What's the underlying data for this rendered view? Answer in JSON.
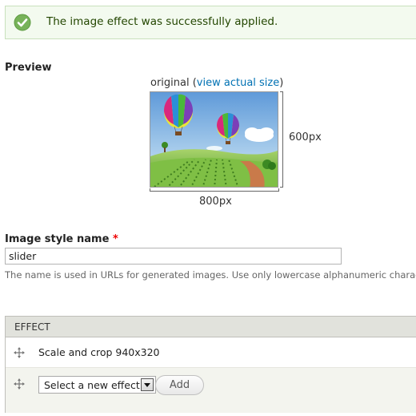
{
  "status": {
    "icon": "check-circle-icon",
    "message": "The image effect was successfully applied.",
    "color": "#77b259"
  },
  "preview": {
    "label": "Preview",
    "caption_prefix": "original (",
    "caption_link": "view actual size",
    "caption_suffix": ")",
    "height_label": "600px",
    "width_label": "800px",
    "image": "hot-air-balloons-landscape"
  },
  "form": {
    "name_label": "Image style name",
    "required_mark": "*",
    "name_value": "slider",
    "description": "The name is used in URLs for generated images. Use only lowercase alphanumeric charac"
  },
  "effects": {
    "header": "EFFECT",
    "rows": [
      {
        "label": "Scale and crop 940x320",
        "icon": "drag-handle-icon"
      }
    ],
    "new_effect": {
      "icon": "drag-handle-icon",
      "select_value": "Select a new effect",
      "add_label": "Add"
    }
  },
  "colors": {
    "link": "#0071b3",
    "required": "#ee0000",
    "header_bg": "#e1e2dc"
  }
}
